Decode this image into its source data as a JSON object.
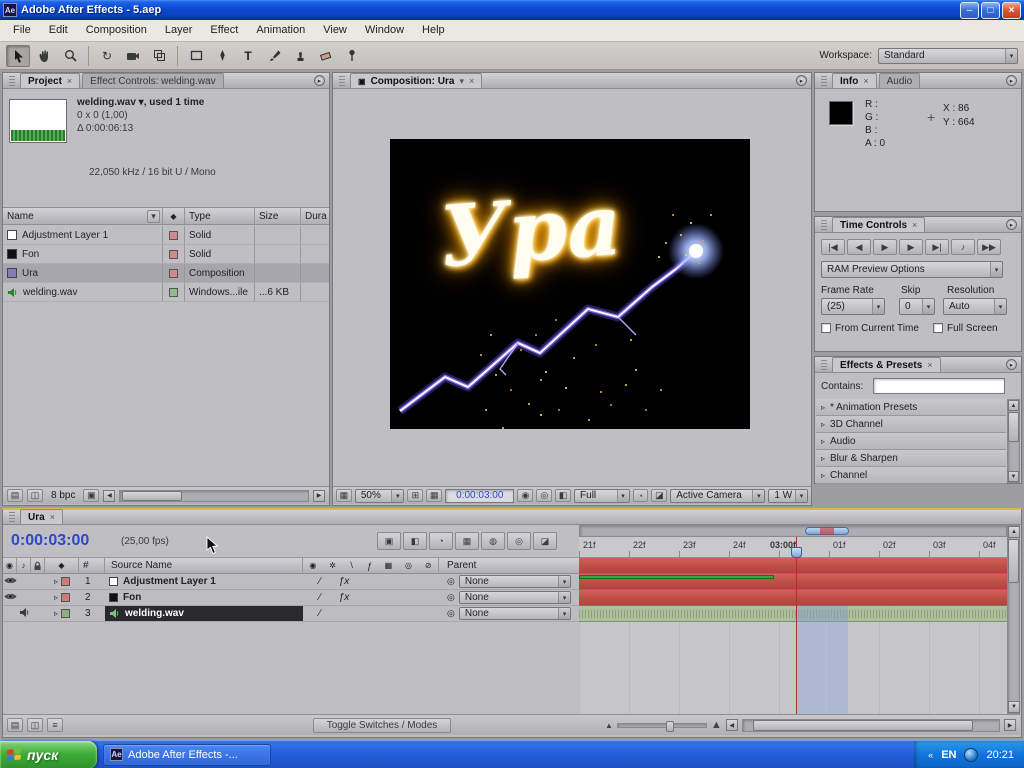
{
  "colors": {
    "xp_titlebar": "#0b46cc",
    "taskbar_blue": "#245edc",
    "start_green": "#3fae3a",
    "panel_gray": "#bfbec3",
    "layer_bar_red": "#c3524a",
    "audio_bar_green": "#aebf9e",
    "timecode_blue": "#2b49c8",
    "selection_black": "#2a2a2e"
  },
  "titlebar": {
    "app_initials": "Ae",
    "title": "Adobe After Effects - 5.aep",
    "minimize": "–",
    "maximize": "□",
    "close": "×"
  },
  "menu": {
    "items": [
      "File",
      "Edit",
      "Composition",
      "Layer",
      "Effect",
      "Animation",
      "View",
      "Window",
      "Help"
    ]
  },
  "toolbar": {
    "workspace_label": "Workspace:",
    "workspace_value": "Standard"
  },
  "project": {
    "tab_project": "Project",
    "tab_effect_controls": "Effect Controls: welding.wav",
    "close_glyph": "×",
    "info_title": "welding.wav ▾, used 1 time",
    "info_dims": "0 x 0 (1,00)",
    "info_duration": "Δ 0:00:06:13",
    "info_audio": "22,050 kHz / 16 bit U / Mono",
    "col_name": "Name",
    "col_type": "Type",
    "col_size": "Size",
    "col_duration": "Dura",
    "rows": [
      {
        "name": "Adjustment Layer 1",
        "type": "Solid",
        "size": "",
        "duration": ""
      },
      {
        "name": "Fon",
        "type": "Solid",
        "size": "",
        "duration": ""
      },
      {
        "name": "Ura",
        "type": "Composition",
        "size": "",
        "duration": ""
      },
      {
        "name": "welding.wav",
        "type": "Windows...ile",
        "size": "...6 KB",
        "duration": ""
      }
    ],
    "bpc": "8 bpc"
  },
  "composition": {
    "tab": "Composition: Ura",
    "close_glyph": "×",
    "artwork_text": "Ура",
    "zoom": "50%",
    "timecode": "0:00:03:00",
    "resolution": "Full",
    "camera": "Active Camera",
    "view_layout": "1 W"
  },
  "info_panel": {
    "tab_info": "Info",
    "tab_audio": "Audio",
    "close_glyph": "×",
    "r": "R :",
    "g": "G :",
    "b": "B :",
    "a": "A : 0",
    "plus": "+",
    "x": "X : 86",
    "y": "Y : 664"
  },
  "time_controls": {
    "title": "Time Controls",
    "close_glyph": "×",
    "transport": [
      {
        "name": "first-frame",
        "glyph": "|◀"
      },
      {
        "name": "previous-frame",
        "glyph": "◀"
      },
      {
        "name": "play",
        "glyph": "▶"
      },
      {
        "name": "next-frame",
        "glyph": "▶"
      },
      {
        "name": "last-frame",
        "glyph": "▶|"
      },
      {
        "name": "audio",
        "glyph": "♪"
      },
      {
        "name": "ram-preview",
        "glyph": "▶▶"
      }
    ],
    "ram_preview_options": "RAM Preview Options",
    "frame_rate_label": "Frame Rate",
    "skip_label": "Skip",
    "resolution_label": "Resolution",
    "frame_rate_value": "(25)",
    "skip_value": "0",
    "resolution_value": "Auto",
    "from_current_time": "From Current Time",
    "full_screen": "Full Screen"
  },
  "effects_presets": {
    "title": "Effects & Presets",
    "close_glyph": "×",
    "contains_label": "Contains:",
    "items": [
      "* Animation Presets",
      "3D Channel",
      "Audio",
      "Blur & Sharpen",
      "Channel"
    ]
  },
  "timeline": {
    "tab": "Ura",
    "close_glyph": "×",
    "timecode": "0:00:03:00",
    "fps": "(25,00 fps)",
    "col_hash": "#",
    "col_source": "Source Name",
    "col_parent": "Parent",
    "layers": [
      {
        "num": "1",
        "name": "Adjustment Layer 1",
        "parent": "None"
      },
      {
        "num": "2",
        "name": "Fon",
        "parent": "None"
      },
      {
        "num": "3",
        "name": "welding.wav",
        "parent": "None"
      }
    ],
    "ruler": [
      "21f",
      "22f",
      "23f",
      "24f",
      "03:00f",
      "01f",
      "02f",
      "03f",
      "04f"
    ],
    "toggle_button": "Toggle Switches / Modes"
  },
  "taskbar": {
    "start": "пуск",
    "task": "Adobe After Effects -...",
    "lang": "EN",
    "time": "20:21"
  }
}
